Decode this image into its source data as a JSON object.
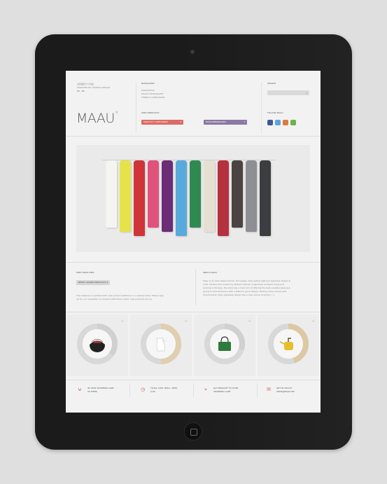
{
  "header": {
    "japanese": "北欧雑貨マウ北欧",
    "tagline": "SELECTED BY YOSHIDA DESIGN",
    "tagline2": "03 · 06",
    "logo": "MAAU",
    "navigation_title": "NAVIGATION",
    "nav_items": [
      "START/SHOP",
      "MAAU'S PHILOSOPHY",
      "TERMS & CONDITIONS"
    ],
    "sort_products_title": "SORT PRODUCTS",
    "product_categories": "PRODUCT CATEGORIES",
    "designer_brands": "DESIGNER/BRANDS",
    "search_title": "SEARCH",
    "follow_title": "FOLLOW MAAU"
  },
  "colors": {
    "accent_red": "#dc6b66",
    "accent_purple": "#8b78a3",
    "social": [
      "#3b5998",
      "#5aa7df",
      "#e07a3a",
      "#6bb34a"
    ]
  },
  "social_icons": [
    "facebook-icon",
    "twitter-icon",
    "rss-icon",
    "share-icon"
  ],
  "towels": [
    "#f4f4f0",
    "#e6e34a",
    "#cf3438",
    "#e0527b",
    "#6a2d76",
    "#5aa9dc",
    "#2f8a52",
    "#e6e0d2",
    "#b6313e",
    "#4a4341",
    "#8e8f92",
    "#3b3d40"
  ],
  "sort": {
    "title": "SORT MAIN VIEW",
    "selected": "NEWLY ADDED PRODUCTS",
    "text": [
      "The webshop is updated with new product additions on a weekly basis. Please sign",
      "up for our newsletter to receive notifications when new products are up."
    ]
  },
  "about": {
    "title": "ABOUT MAAU",
    "text": [
      "Maau is an Oslo based interior and design shop selling high-end Japanese design &",
      "craft. Started and curated by Motoko Yoshida, a Japanese architect living and",
      "working in Norway, the shop has a clear aim of offering the best possible Japanese",
      "goods to Scandinavians with a taste for good design. Sharing many values with",
      "Scandinavian style, Japanese design has a clear sense of purity [...]"
    ]
  },
  "products": [
    {
      "icon": "black-pot-icon",
      "fill": 0.35
    },
    {
      "icon": "white-vase-icon",
      "fill": 0.5
    },
    {
      "icon": "green-bag-icon",
      "fill": 0.3
    },
    {
      "icon": "yellow-teapot-icon",
      "fill": 0.45
    }
  ],
  "footer": [
    {
      "icon": "cart-icon",
      "line1": "IN YOUR SHOPPING CART:",
      "line2": "00 ITEMS"
    },
    {
      "icon": "cost-icon",
      "line1": "TOTAL COST (EXCL. SHIP):",
      "line2": "0,00"
    },
    {
      "icon": "arrow-icon",
      "line1": "GO STRAIGHT TO YOUR",
      "line2": "SHOPPING CART"
    },
    {
      "icon": "mail-icon",
      "line1": "GET IN TOUCH",
      "line2": "SHOP@MAAU.NO"
    }
  ]
}
